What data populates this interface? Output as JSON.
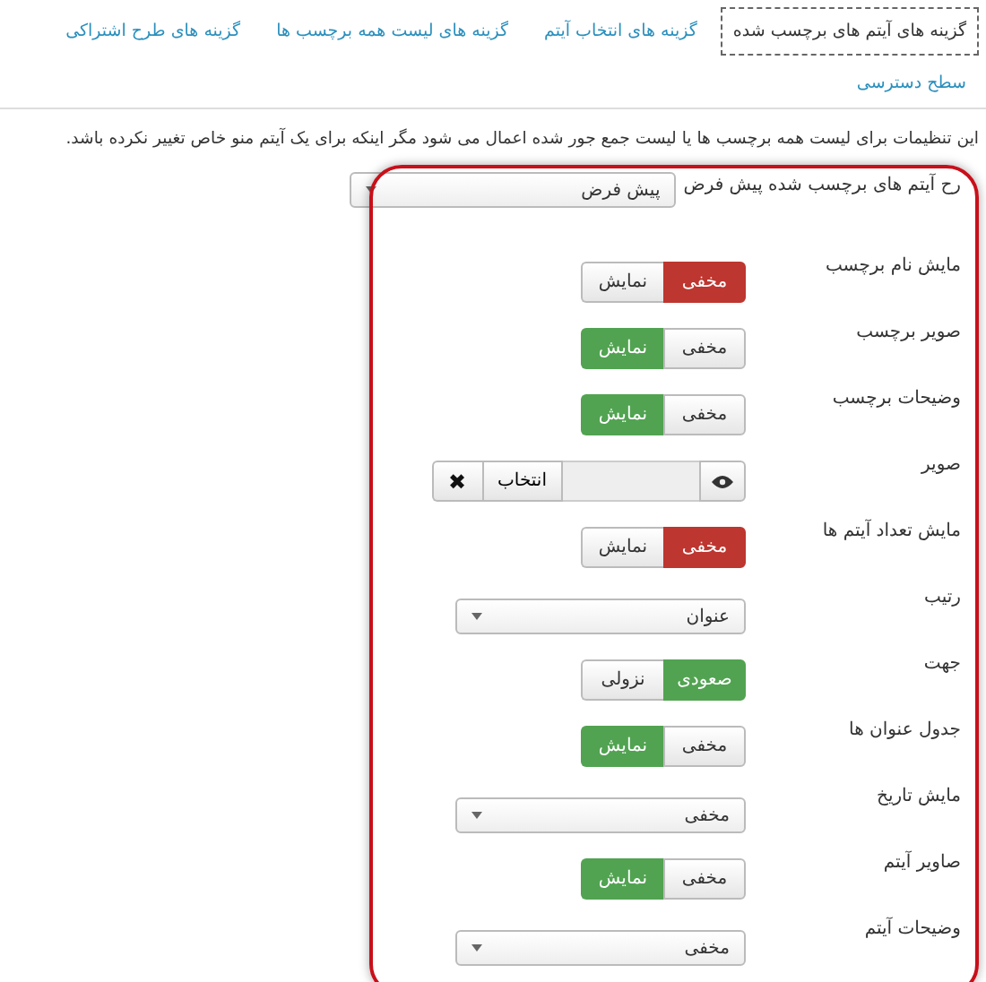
{
  "tabs": [
    {
      "label": "گزینه های آیتم های برچسب شده",
      "selected": true
    },
    {
      "label": "گزینه های انتخاب آیتم",
      "selected": false
    },
    {
      "label": "گزینه های لیست همه برچسب ها",
      "selected": false
    },
    {
      "label": "گزینه های طرح اشتراکی",
      "selected": false
    },
    {
      "label": "سطح دسترسی",
      "selected": false
    }
  ],
  "description": "این تنظیمات برای لیست همه برچسب ها یا لیست جمع جور شده اعمال می شود مگر اینکه برای یک آیتم منو خاص تغییر نکرده باشد.",
  "fields": [
    {
      "kind": "select",
      "label": "رح آیتم های برچسب شده پیش فرض",
      "value": "پیش فرض",
      "wide": true
    },
    {
      "kind": "toggle",
      "label": "مایش نام برچسب",
      "color": "#bd362f",
      "options": [
        {
          "label": "مخفی",
          "selected": true
        },
        {
          "label": "نمایش",
          "selected": false
        }
      ]
    },
    {
      "kind": "toggle",
      "label": "صویر برچسب",
      "color": "#51a351",
      "options": [
        {
          "label": "مخفی",
          "selected": false
        },
        {
          "label": "نمایش",
          "selected": true
        }
      ]
    },
    {
      "kind": "toggle",
      "label": "وضیحات برچسب",
      "color": "#51a351",
      "options": [
        {
          "label": "مخفی",
          "selected": false
        },
        {
          "label": "نمایش",
          "selected": true
        }
      ]
    },
    {
      "kind": "media",
      "label": "صویر",
      "button": "انتخاب",
      "clear": "✖"
    },
    {
      "kind": "toggle",
      "label": "مایش تعداد آیتم ها",
      "color": "#bd362f",
      "options": [
        {
          "label": "مخفی",
          "selected": true
        },
        {
          "label": "نمایش",
          "selected": false
        }
      ]
    },
    {
      "kind": "select",
      "label": "رتیب",
      "value": "عنوان",
      "wide": false
    },
    {
      "kind": "toggle",
      "label": "جهت",
      "color": "#51a351",
      "options": [
        {
          "label": "صعودی",
          "selected": true
        },
        {
          "label": "نزولی",
          "selected": false
        }
      ]
    },
    {
      "kind": "toggle",
      "label": "جدول عنوان ها",
      "color": "#51a351",
      "options": [
        {
          "label": "مخفی",
          "selected": false
        },
        {
          "label": "نمایش",
          "selected": true
        }
      ]
    },
    {
      "kind": "select",
      "label": "مایش تاریخ",
      "value": "مخفی",
      "wide": false
    },
    {
      "kind": "toggle",
      "label": "صاویر آیتم",
      "color": "#51a351",
      "options": [
        {
          "label": "مخفی",
          "selected": false
        },
        {
          "label": "نمایش",
          "selected": true
        }
      ]
    },
    {
      "kind": "select",
      "label": "وضیحات آیتم",
      "value": "مخفی",
      "wide": false
    }
  ]
}
